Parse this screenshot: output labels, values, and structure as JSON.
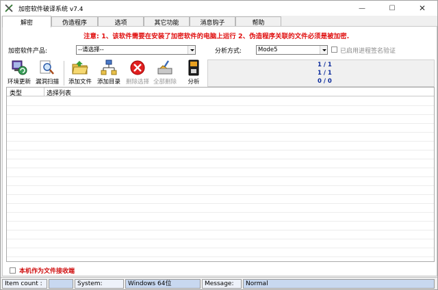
{
  "window": {
    "title": "加密软件破译系统  v7.4",
    "minimize": "—",
    "maximize": "☐",
    "close": "✕"
  },
  "tabs": [
    "解密",
    "伪造程序",
    "选项",
    "其它功能",
    "消息钩子",
    "帮助"
  ],
  "notice": "注意: 1、该软件需要在安装了加密软件的电脑上运行   2、伪造程序关联的文件必须是被加密.",
  "form": {
    "product_label": "加密软件产品:",
    "product_value": "--请选择--",
    "mode_label": "分析方式:",
    "mode_value": "Mode5",
    "verify_label": "已启用进程签名验证"
  },
  "toolbar": [
    {
      "label": "环境更新",
      "icon": "environment-update-icon",
      "enabled": true
    },
    {
      "label": "漏洞扫描",
      "icon": "magnifier-scan-icon",
      "enabled": true
    },
    {
      "label": "添加文件",
      "icon": "open-folder-icon",
      "enabled": true
    },
    {
      "label": "添加目录",
      "icon": "directory-tree-icon",
      "enabled": true
    },
    {
      "label": "删除选择",
      "icon": "delete-icon",
      "enabled": false
    },
    {
      "label": "全部删除",
      "icon": "broom-icon",
      "enabled": false
    },
    {
      "label": "分析",
      "icon": "disk-icon",
      "enabled": true
    }
  ],
  "counters": [
    "1 / 1",
    "1 / 1",
    "0 / 0"
  ],
  "list": {
    "columns": [
      "类型",
      "选择列表"
    ]
  },
  "receiver_label": "本机作为文件接收端",
  "status": {
    "item_count_label": "Item count :",
    "item_count_value": "",
    "system_label": "System:",
    "system_value": "Windows  64位",
    "message_label": "Message:",
    "message_value": "Normal"
  },
  "colors": {
    "notice": "#e01010",
    "counter": "#0a2a9c",
    "status_field": "#c8d8f0"
  }
}
